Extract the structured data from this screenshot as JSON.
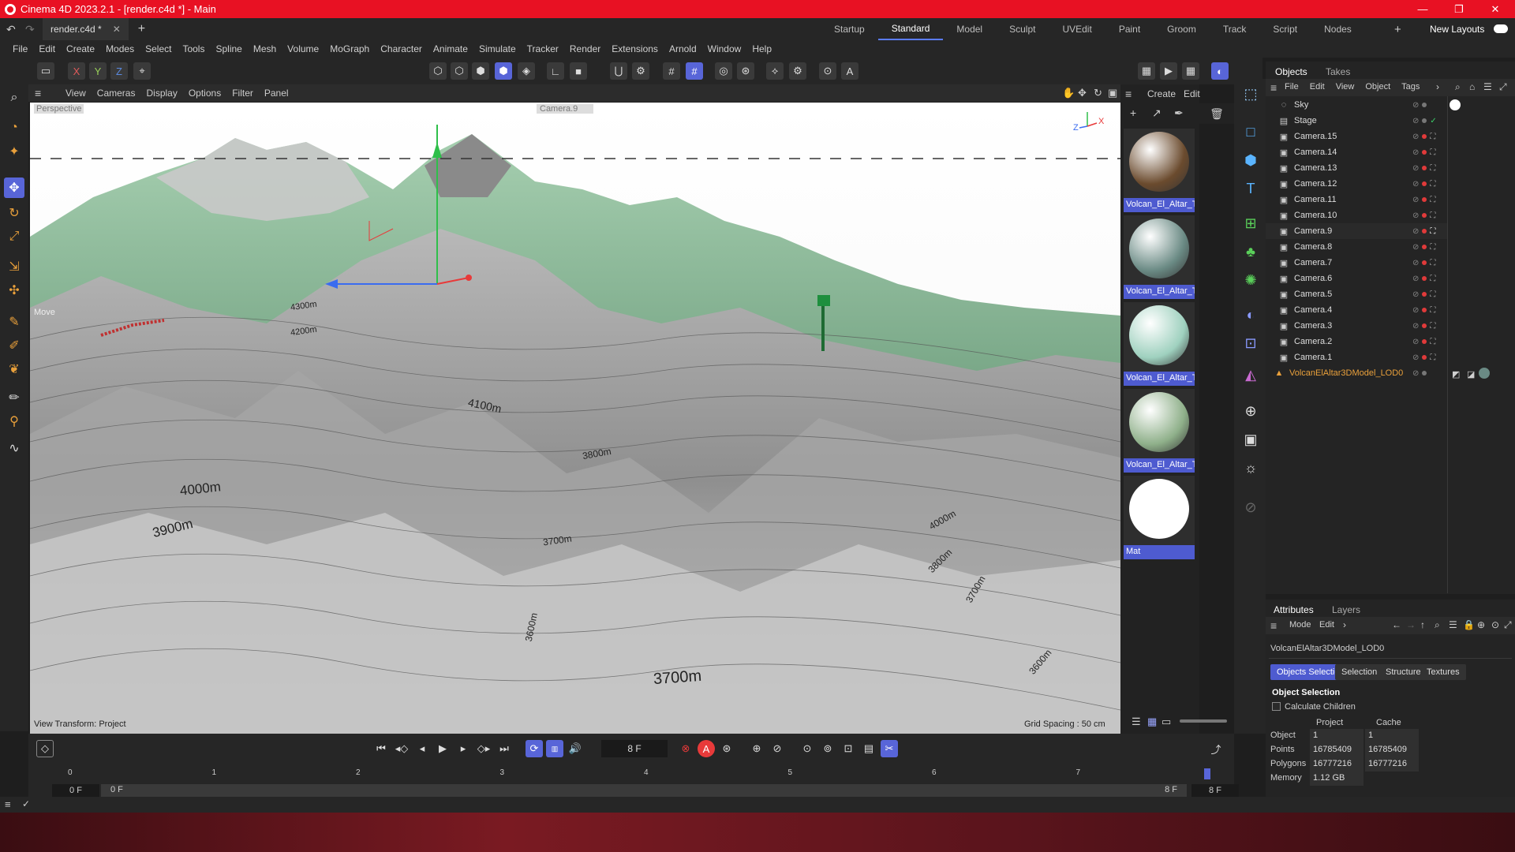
{
  "window": {
    "title": "Cinema 4D 2023.2.1 - [render.c4d *] - Main"
  },
  "doc_tab": {
    "label": "render.c4d *"
  },
  "layout_tabs": [
    "Startup",
    "Standard",
    "Model",
    "Sculpt",
    "UVEdit",
    "Paint",
    "Groom",
    "Track",
    "Script",
    "Nodes"
  ],
  "layout_active": "Standard",
  "new_layouts": "New Layouts",
  "menu": [
    "File",
    "Edit",
    "Create",
    "Modes",
    "Select",
    "Tools",
    "Spline",
    "Mesh",
    "Volume",
    "MoGraph",
    "Character",
    "Animate",
    "Simulate",
    "Tracker",
    "Render",
    "Extensions",
    "Arnold",
    "Window",
    "Help"
  ],
  "axis_buttons": [
    "X",
    "Y",
    "Z"
  ],
  "viewport": {
    "menu": [
      "View",
      "Cameras",
      "Display",
      "Options",
      "Filter",
      "Panel"
    ],
    "projection": "Perspective",
    "camera": "Camera.9",
    "tool_label": "Move",
    "view_transform": "View Transform: Project",
    "grid_spacing": "Grid Spacing : 50 cm",
    "contours": [
      "4300m",
      "4200m",
      "4100m",
      "4000m",
      "3900m",
      "3800m",
      "3700m",
      "3700m",
      "3600m",
      "3600m",
      "3800m",
      "4000m",
      "3700m"
    ],
    "axis_z": "Z",
    "axis_x": "X"
  },
  "materials": {
    "menu": [
      "Create",
      "Edit"
    ],
    "items": [
      {
        "label": "Volcan_El_Altar_Te",
        "color": "#6b4b2e"
      },
      {
        "label": "Volcan_El_Altar_Te",
        "color": "#6a8a84"
      },
      {
        "label": "Volcan_El_Altar_Te",
        "color": "#9fd1bf"
      },
      {
        "label": "Volcan_El_Altar_Te",
        "color": "#8fb08a"
      },
      {
        "label": "Mat",
        "color": "#ffffff"
      }
    ]
  },
  "objects": {
    "tabs": [
      "Objects",
      "Takes"
    ],
    "menu": [
      "File",
      "Edit",
      "View",
      "Object",
      "Tags"
    ],
    "items": [
      "Sky",
      "Stage",
      "Camera.15",
      "Camera.14",
      "Camera.13",
      "Camera.12",
      "Camera.11",
      "Camera.10",
      "Camera.9",
      "Camera.8",
      "Camera.7",
      "Camera.6",
      "Camera.5",
      "Camera.4",
      "Camera.3",
      "Camera.2",
      "Camera.1",
      "VolcanElAltar3DModel_LOD0"
    ]
  },
  "attributes": {
    "tabs": [
      "Attributes",
      "Layers"
    ],
    "menu": [
      "Mode",
      "Edit"
    ],
    "object_name": "VolcanElAltar3DModel_LOD0",
    "sub_tabs": [
      "Objects Selection",
      "Selection",
      "Structure",
      "Textures"
    ],
    "section": "Object Selection",
    "calculate_children": "Calculate Children",
    "col_project": "Project",
    "col_cache": "Cache",
    "rows": [
      {
        "label": "Object",
        "project": "1",
        "cache": "1"
      },
      {
        "label": "Points",
        "project": "16785409",
        "cache": "16785409"
      },
      {
        "label": "Polygons",
        "project": "16777216",
        "cache": "16777216"
      },
      {
        "label": "Memory",
        "project": "1.12 GB",
        "cache": ""
      }
    ]
  },
  "timeline": {
    "current_frame": "8 F",
    "ticks": [
      "0",
      "1",
      "2",
      "3",
      "4",
      "5",
      "6",
      "7"
    ],
    "start_field": "0 F",
    "range_start": "0 F",
    "range_end": "8 F",
    "end_field": "8 F",
    "playhead_fraction": 1.0
  }
}
